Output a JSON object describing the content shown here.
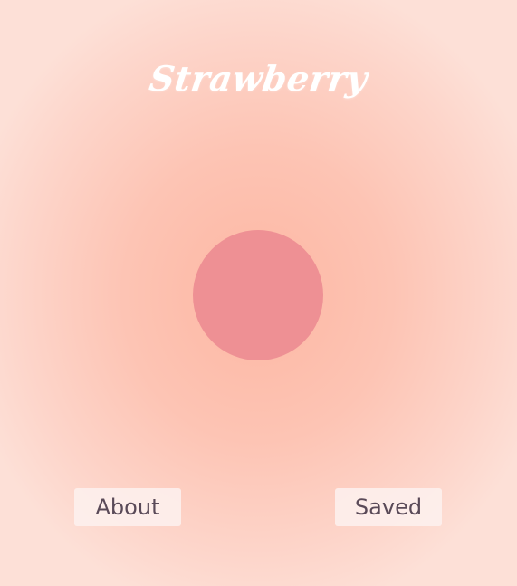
{
  "app": {
    "title": "Strawberry"
  },
  "fruit": {
    "color": "#ee9094"
  },
  "buttons": {
    "about_label": "About",
    "saved_label": "Saved"
  },
  "colors": {
    "background_center": "#fdb7a3",
    "background_edge": "#fde0d7",
    "button_text": "#5a4a58",
    "title_text": "#ffffff"
  }
}
